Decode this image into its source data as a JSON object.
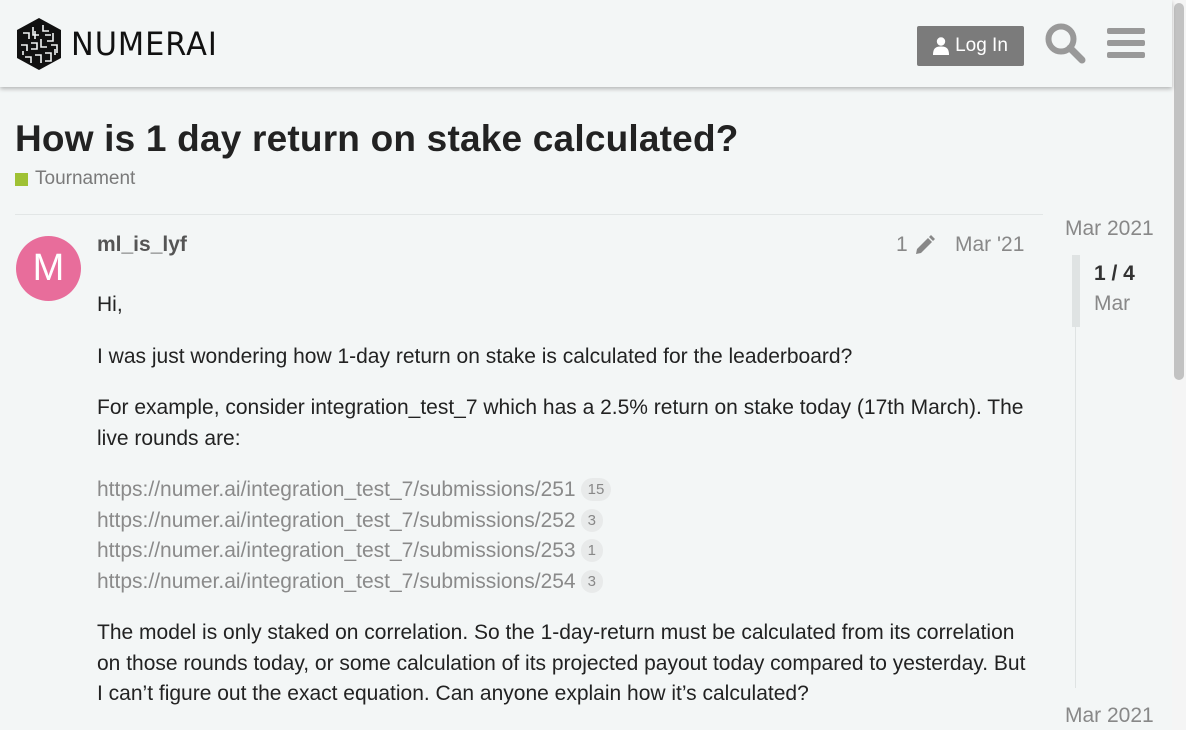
{
  "header": {
    "logo_text": "NUMERAI",
    "login_label": "Log In",
    "icons": [
      "numerai-logo-icon",
      "user-icon",
      "search-icon",
      "menu-icon"
    ]
  },
  "topic": {
    "title": "How is 1 day return on stake calculated?",
    "category": "Tournament",
    "category_color": "#9fc134"
  },
  "post": {
    "avatar_letter": "M",
    "avatar_color": "#e86d9b",
    "username": "ml_is_lyf",
    "edit_count": "1",
    "date": "Mar '21",
    "greeting": "Hi,",
    "para1": "I was just wondering how 1-day return on stake is calculated for the leaderboard?",
    "para2": "For example, consider integration_test_7 which has a 2.5% return on stake today (17th March). The live rounds are:",
    "links": [
      {
        "url": "https://numer.ai/integration_test_7/submissions/251",
        "clicks": "15"
      },
      {
        "url": "https://numer.ai/integration_test_7/submissions/252",
        "clicks": "3"
      },
      {
        "url": "https://numer.ai/integration_test_7/submissions/253",
        "clicks": "1"
      },
      {
        "url": "https://numer.ai/integration_test_7/submissions/254",
        "clicks": "3"
      }
    ],
    "para3": "The model is only staked on correlation. So the 1-day-return must be calculated from its correlation on those rounds today, or some calculation of its projected payout today compared to yesterday. But I can’t figure out the exact equation. Can anyone explain how it’s calculated?"
  },
  "timeline": {
    "start_date": "Mar 2021",
    "position": "1 / 4",
    "current_month": "Mar",
    "end_date": "Mar 2021"
  }
}
